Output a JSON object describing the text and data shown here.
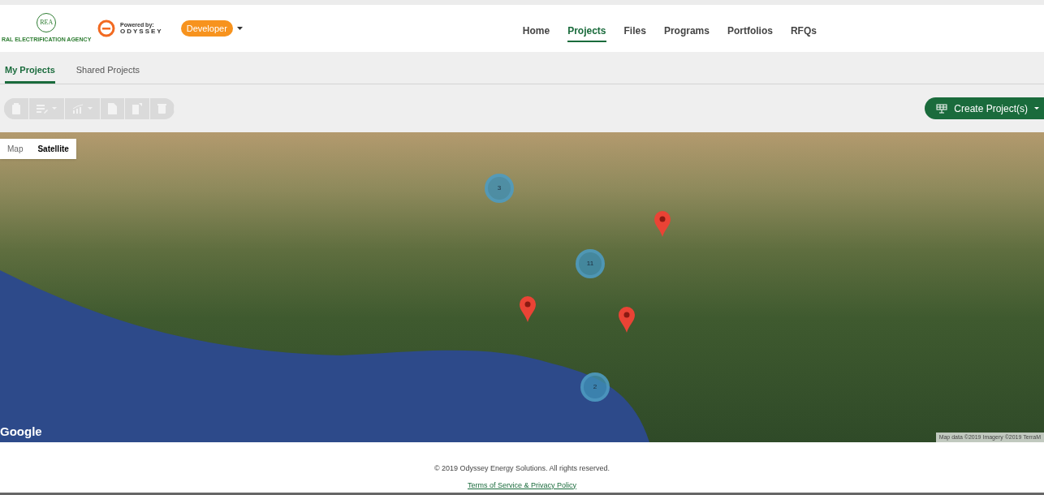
{
  "header": {
    "logo": {
      "initials": "REA",
      "caption": "RAL ELECTRIFICATION AGENCY"
    },
    "powered_by": {
      "label": "Powered by:",
      "brand": "ODYSSEY"
    },
    "role": {
      "label": "Developer"
    },
    "nav": [
      {
        "label": "Home",
        "selected": false
      },
      {
        "label": "Projects",
        "selected": true
      },
      {
        "label": "Files",
        "selected": false
      },
      {
        "label": "Programs",
        "selected": false
      },
      {
        "label": "Portfolios",
        "selected": false
      },
      {
        "label": "RFQs",
        "selected": false
      }
    ]
  },
  "tabs": [
    {
      "label": "My Projects",
      "selected": true
    },
    {
      "label": "Shared Projects",
      "selected": false
    }
  ],
  "toolbar": [
    {
      "kind": "clipboard",
      "dropdown": false,
      "disabled": true
    },
    {
      "kind": "list",
      "dropdown": true,
      "disabled": true
    },
    {
      "kind": "chart",
      "dropdown": true,
      "disabled": true
    },
    {
      "kind": "file",
      "dropdown": false,
      "disabled": true
    },
    {
      "kind": "edit",
      "dropdown": false,
      "disabled": true
    },
    {
      "kind": "trash",
      "dropdown": false,
      "disabled": true
    }
  ],
  "create_button": {
    "label": "Create Project(s)"
  },
  "map": {
    "types": [
      {
        "label": "Map",
        "selected": false
      },
      {
        "label": "Satellite",
        "selected": true
      }
    ],
    "markers": [
      {
        "kind": "cluster",
        "count": "3"
      },
      {
        "kind": "cluster",
        "count": "11"
      },
      {
        "kind": "cluster",
        "count": "2"
      },
      {
        "kind": "pin"
      },
      {
        "kind": "pin"
      },
      {
        "kind": "pin"
      }
    ],
    "logo": "Google",
    "attribution": "Map data ©2019 Imagery ©2019 TerraM"
  },
  "footer": {
    "copyright": "© 2019 Odyssey Energy Solutions. All rights reserved.",
    "link": "Terms of Service & Privacy Policy"
  }
}
